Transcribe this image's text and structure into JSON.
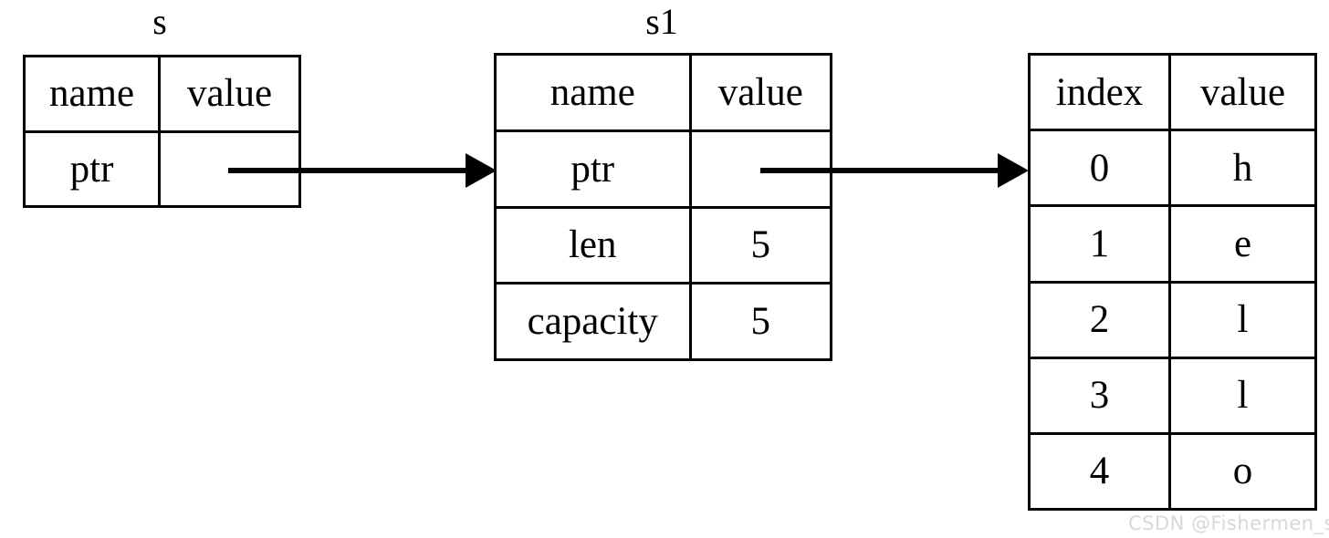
{
  "diagram": {
    "title_s": "s",
    "title_s1": "s1",
    "watermark": "CSDN @Fishermen_sail",
    "stroke_color": "#000000",
    "background_color": "#ffffff",
    "watermark_color": "#d8d8d8"
  },
  "table_s": {
    "caption": "s",
    "headers": [
      "name",
      "value"
    ],
    "rows": [
      {
        "name": "ptr",
        "value": ""
      }
    ]
  },
  "table_s1": {
    "caption": "s1",
    "headers": [
      "name",
      "value"
    ],
    "rows": [
      {
        "name": "ptr",
        "value": ""
      },
      {
        "name": "len",
        "value": "5"
      },
      {
        "name": "capacity",
        "value": "5"
      }
    ]
  },
  "table_buffer": {
    "caption": "",
    "headers": [
      "index",
      "value"
    ],
    "rows": [
      {
        "index": "0",
        "value": "h"
      },
      {
        "index": "1",
        "value": "e"
      },
      {
        "index": "2",
        "value": "l"
      },
      {
        "index": "3",
        "value": "l"
      },
      {
        "index": "4",
        "value": "o"
      }
    ]
  },
  "arrows": [
    {
      "name": "s-ptr-to-s1",
      "from": "table_s.ptr.value",
      "to": "table_s1"
    },
    {
      "name": "s1-ptr-to-buffer",
      "from": "table_s1.ptr.value",
      "to": "table_buffer"
    }
  ]
}
